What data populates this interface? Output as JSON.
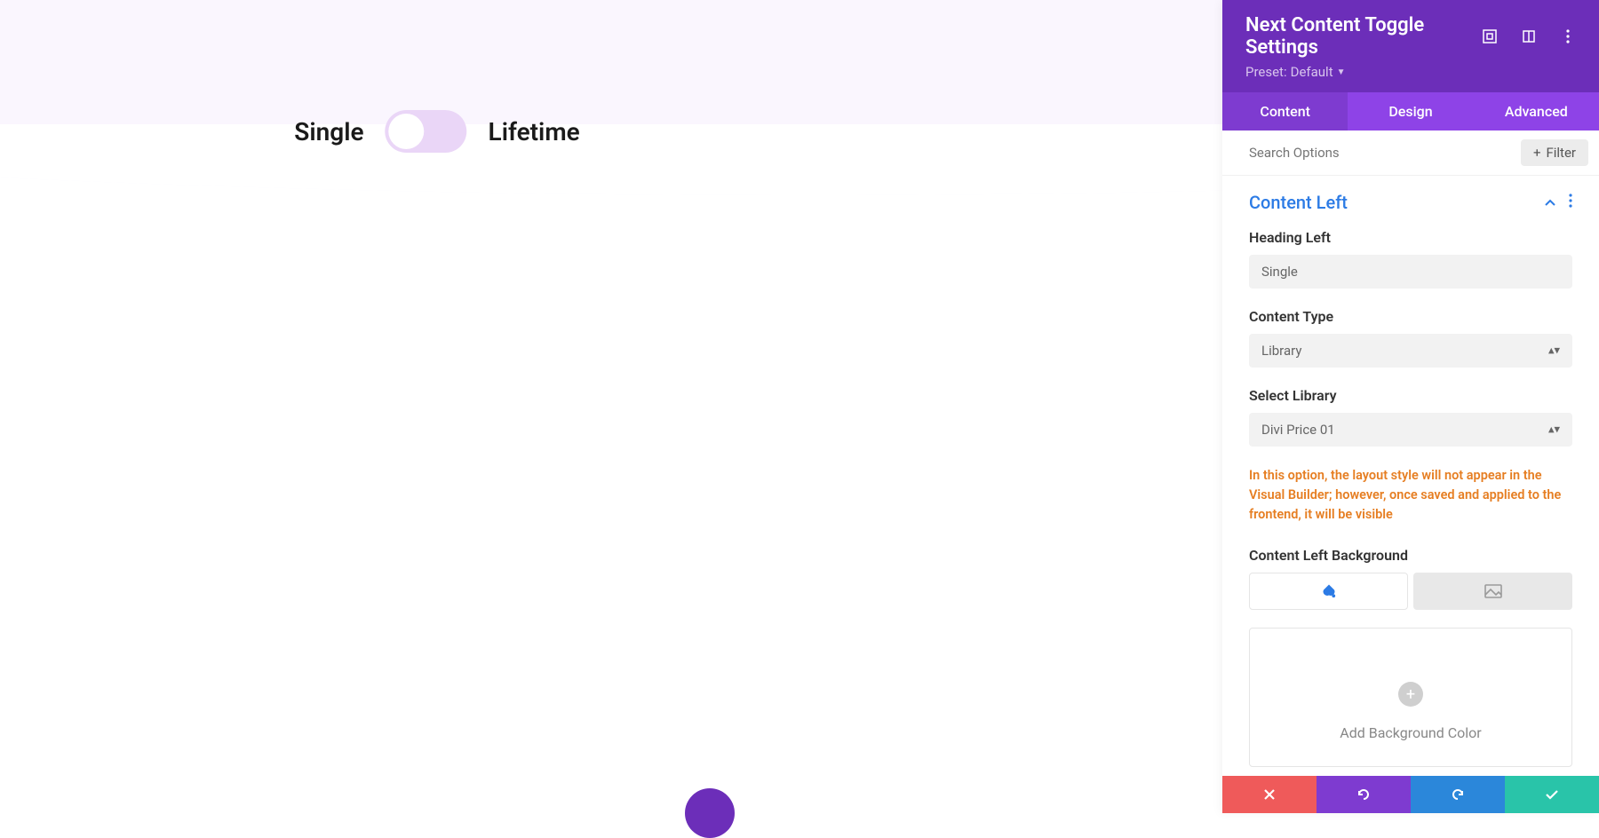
{
  "preview": {
    "leftLabel": "Single",
    "rightLabel": "Lifetime"
  },
  "panel": {
    "title": "Next Content Toggle Settings",
    "presetLabel": "Preset:",
    "presetValue": "Default",
    "tabs": {
      "content": "Content",
      "design": "Design",
      "advanced": "Advanced"
    },
    "searchPlaceholder": "Search Options",
    "filterLabel": "Filter",
    "section": {
      "title": "Content Left",
      "headingLeft": {
        "label": "Heading Left",
        "value": "Single"
      },
      "contentType": {
        "label": "Content Type",
        "value": "Library"
      },
      "selectLibrary": {
        "label": "Select Library",
        "value": "Divi Price 01"
      },
      "warning": "In this option, the layout style will not appear in the Visual Builder; however, once saved and applied to the frontend, it will be visible",
      "bgLabel": "Content Left Background",
      "addBgLabel": "Add Background Color"
    }
  }
}
